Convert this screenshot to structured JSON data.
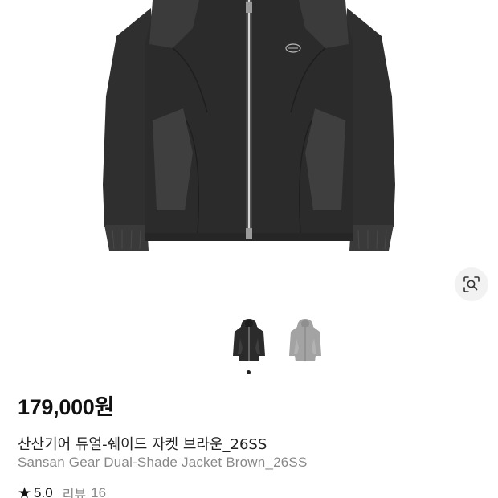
{
  "product": {
    "price": "179,000원",
    "name_ko": "산산기어 듀얼-쉐이드 자켓 브라운_26SS",
    "name_en": "Sansan Gear Dual-Shade Jacket Brown_26SS",
    "rating_score": "5.0",
    "review_label": "리뷰",
    "review_count": "16"
  },
  "gallery": {
    "thumbnails": [
      {
        "icon": "jacket-black-thumbnail",
        "color": "#2b2b2b"
      },
      {
        "icon": "jacket-gray-thumbnail",
        "color": "#a3a3a3"
      }
    ],
    "active_index": 0
  },
  "icons": {
    "lens": "lens-search-icon",
    "star": "star-icon"
  },
  "colors": {
    "jacket_body": "#2f2f2f",
    "jacket_panel": "#3d3d3d",
    "price_text": "#111111",
    "secondary_text": "#888888"
  }
}
